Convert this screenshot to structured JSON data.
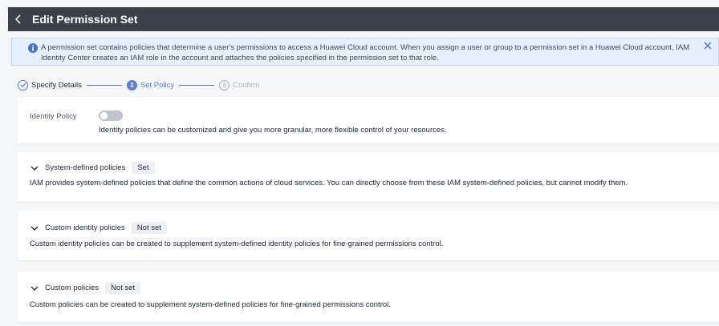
{
  "header": {
    "title": "Edit Permission Set"
  },
  "info": {
    "message": "A permission set contains policies that determine a user's permissions to access a Huawei Cloud account. When you assign a user or group to a permission set in a Huawei Cloud account, IAM Identity Center creates an IAM role in the account and attaches the policies specified in the permission set to that role."
  },
  "steps": [
    {
      "label": "Specify Details",
      "num": ""
    },
    {
      "label": "Set Policy",
      "num": "2"
    },
    {
      "label": "Confirm",
      "num": "3"
    }
  ],
  "identity_policy": {
    "label": "Identity Policy",
    "enabled": false,
    "description": "Identity policies can be customized and give you more granular, more flexible control of your resources."
  },
  "sections": [
    {
      "title": "System-defined policies",
      "status": "Set",
      "description": "IAM provides system-defined policies that define the common actions of cloud services. You can directly choose from these IAM system-defined policies, but cannot modify them."
    },
    {
      "title": "Custom identity policies",
      "status": "Not set",
      "description": "Custom identity policies can be created to supplement system-defined identity policies for fine-grained permissions control."
    },
    {
      "title": "Custom policies",
      "status": "Not set",
      "description": "Custom policies can be created to supplement system-defined policies for fine-grained permissions control."
    }
  ],
  "colors": {
    "header_bg": "#3c4149",
    "accent": "#5e7ce0",
    "info_bg": "#e5f0fe"
  }
}
